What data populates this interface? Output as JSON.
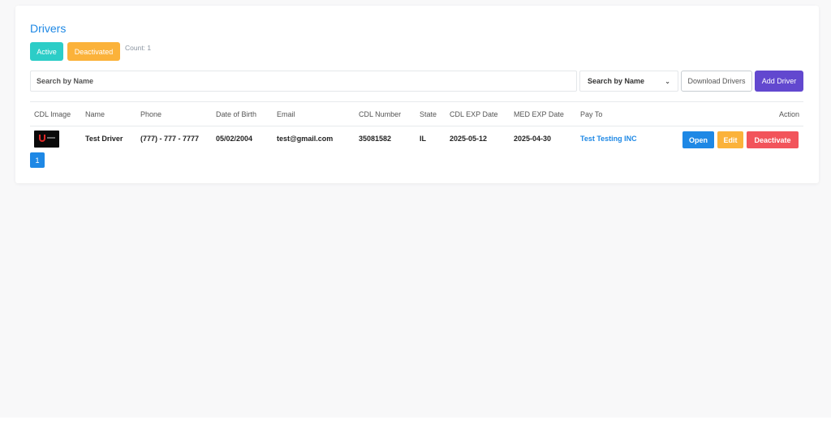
{
  "page": {
    "title": "Drivers"
  },
  "filters": {
    "active_label": "Active",
    "deactivated_label": "Deactivated",
    "count_text": "Count: 1"
  },
  "toolbar": {
    "search_placeholder": "Search by Name",
    "search_select_value": "Search by Name",
    "download_label": "Download Drivers",
    "add_label": "Add Driver"
  },
  "table": {
    "headers": [
      "CDL Image",
      "Name",
      "Phone",
      "Date of Birth",
      "Email",
      "CDL Number",
      "State",
      "CDL EXP Date",
      "MED EXP Date",
      "Pay To",
      "Action"
    ],
    "rows": [
      {
        "name": "Test Driver",
        "phone": "(777) - 777 - 7777",
        "dob": "05/02/2004",
        "email": "test@gmail.com",
        "cdl_number": "35081582",
        "state": "IL",
        "cdl_exp": "2025-05-12",
        "med_exp": "2025-04-30",
        "pay_to": "Test Testing INC",
        "actions": {
          "open": "Open",
          "edit": "Edit",
          "deactivate": "Deactivate"
        }
      }
    ]
  },
  "pagination": {
    "current": "1"
  },
  "colors": {
    "primary": "#1e88e5",
    "teal": "#2ccdc7",
    "warning": "#fbb23a",
    "danger": "#f2545b",
    "purple": "#6248cf"
  }
}
